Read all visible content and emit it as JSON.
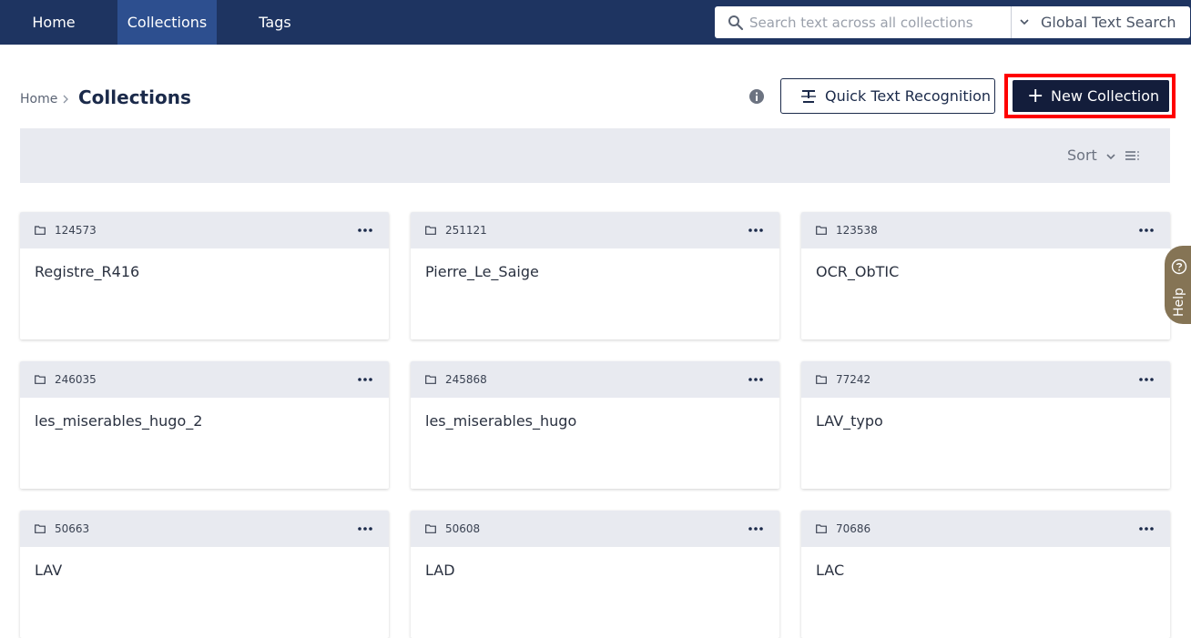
{
  "nav": {
    "items": [
      {
        "label": "Home"
      },
      {
        "label": "Collections"
      },
      {
        "label": "Tags"
      }
    ],
    "active": "Collections"
  },
  "search": {
    "placeholder": "Search text across all collections",
    "mode_label": "Global Text Search"
  },
  "breadcrumb": {
    "home": "Home",
    "current": "Collections"
  },
  "actions": {
    "quick_text_recognition": "Quick Text Recognition",
    "new_collection": "New Collection"
  },
  "toolbar": {
    "sort_label": "Sort"
  },
  "collections": [
    {
      "id": "124573",
      "title": "Registre_R416"
    },
    {
      "id": "251121",
      "title": "Pierre_Le_Saige"
    },
    {
      "id": "123538",
      "title": "OCR_ObTIC"
    },
    {
      "id": "246035",
      "title": "les_miserables_hugo_2"
    },
    {
      "id": "245868",
      "title": "les_miserables_hugo"
    },
    {
      "id": "77242",
      "title": "LAV_typo"
    },
    {
      "id": "50663",
      "title": "LAV"
    },
    {
      "id": "50608",
      "title": "LAD"
    },
    {
      "id": "70686",
      "title": "LAC"
    }
  ],
  "help": {
    "label": "Help"
  },
  "colors": {
    "topbar": "#1e3461",
    "active_tab": "#2d4f8f",
    "primary_button": "#131d3b",
    "highlight": "#ff0000",
    "help_tab": "#857455",
    "card_header": "#e8eaf0"
  }
}
